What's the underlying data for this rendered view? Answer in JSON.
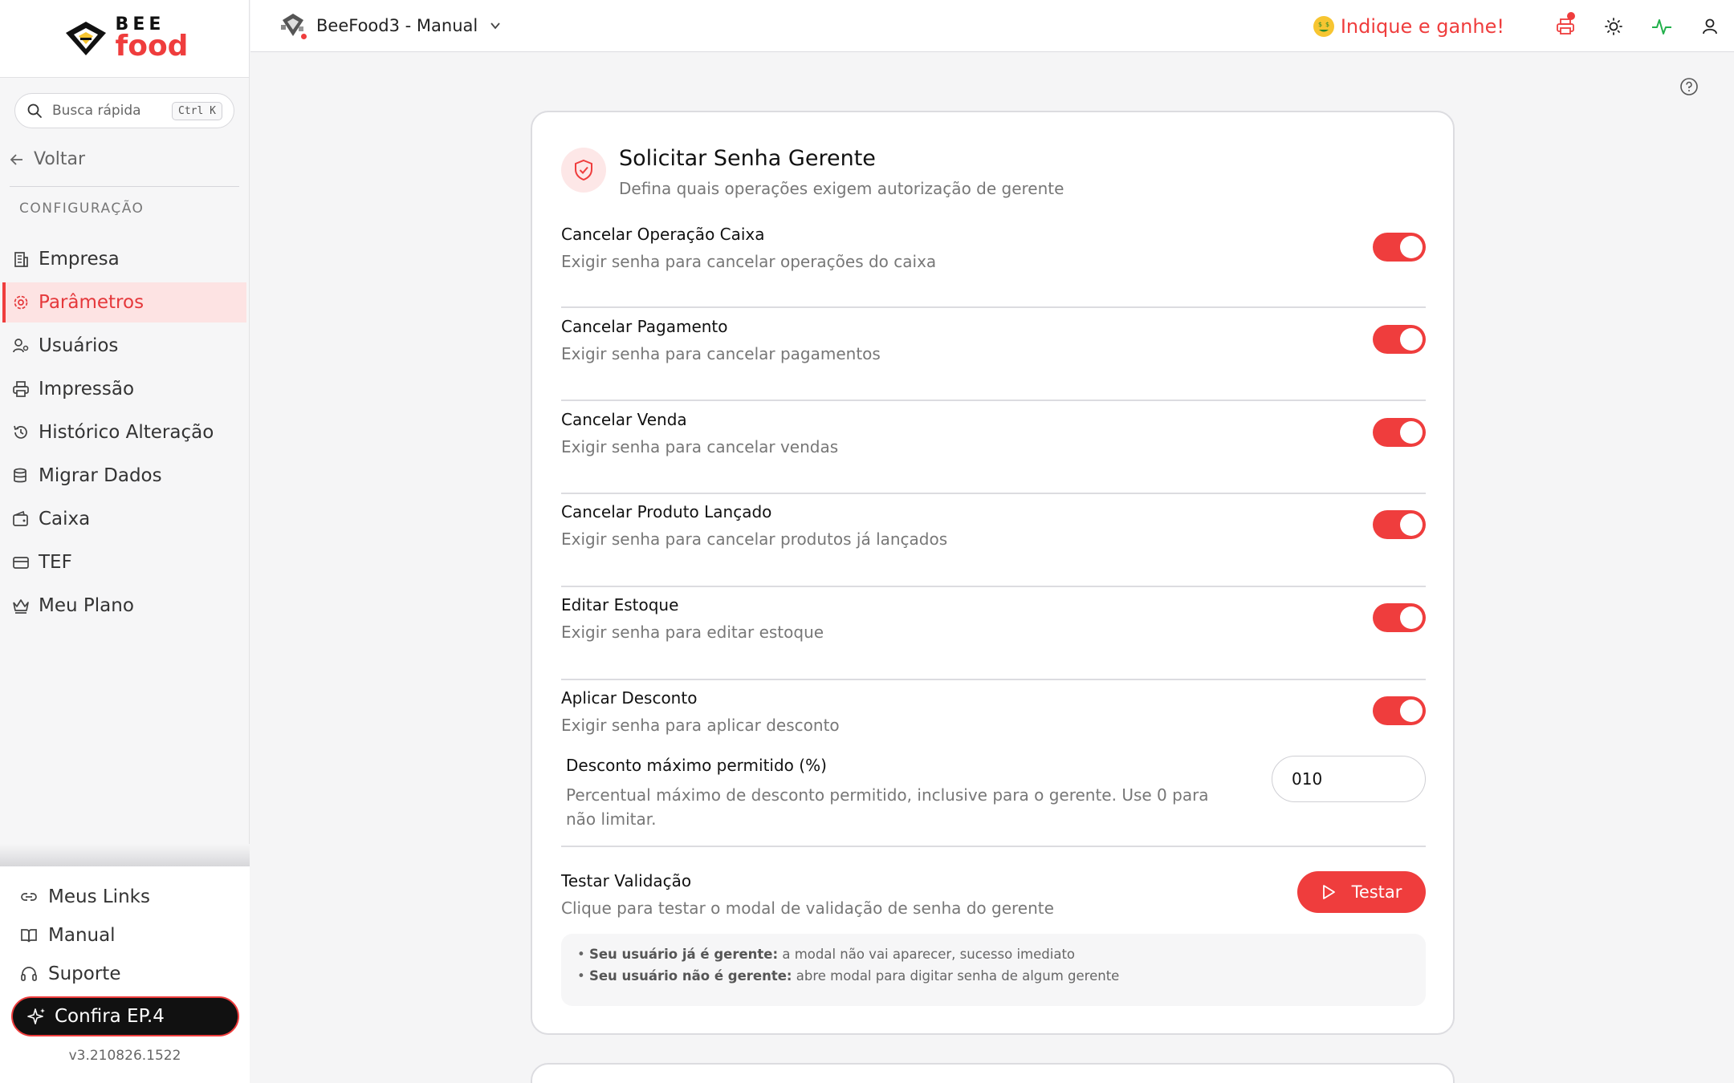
{
  "brand": {
    "line1": "BEE",
    "line2": "food"
  },
  "search": {
    "placeholder": "Busca rápida",
    "shortcut": "Ctrl K"
  },
  "nav_back": "Voltar",
  "section_label": "CONFIGURAÇÃO",
  "sidebar": {
    "items": [
      {
        "label": "Empresa",
        "icon": "building-icon"
      },
      {
        "label": "Parâmetros",
        "icon": "gear-icon",
        "active": true
      },
      {
        "label": "Usuários",
        "icon": "users-icon"
      },
      {
        "label": "Impressão",
        "icon": "printer-icon"
      },
      {
        "label": "Histórico Alteração",
        "icon": "history-icon"
      },
      {
        "label": "Migrar Dados",
        "icon": "database-icon"
      },
      {
        "label": "Caixa",
        "icon": "wallet-icon"
      },
      {
        "label": "TEF",
        "icon": "card-icon"
      },
      {
        "label": "Meu Plano",
        "icon": "crown-icon"
      }
    ],
    "bottom": [
      {
        "label": "Meus Links",
        "icon": "link-icon"
      },
      {
        "label": "Manual",
        "icon": "book-icon"
      },
      {
        "label": "Suporte",
        "icon": "headset-icon"
      }
    ],
    "promo": "Confira EP.4",
    "version": "v3.210826.1522"
  },
  "topbar": {
    "store_name": "BeeFood3 - Manual",
    "referral": "Indique e ganhe!"
  },
  "card": {
    "title": "Solicitar Senha Gerente",
    "subtitle": "Defina quais operações exigem autorização de gerente",
    "options": [
      {
        "label": "Cancelar Operação Caixa",
        "desc": "Exigir senha para cancelar operações do caixa",
        "enabled": true
      },
      {
        "label": "Cancelar Pagamento",
        "desc": "Exigir senha para cancelar pagamentos",
        "enabled": true
      },
      {
        "label": "Cancelar Venda",
        "desc": "Exigir senha para cancelar vendas",
        "enabled": true
      },
      {
        "label": "Cancelar Produto Lançado",
        "desc": "Exigir senha para cancelar produtos já lançados",
        "enabled": true
      },
      {
        "label": "Editar Estoque",
        "desc": "Exigir senha para editar estoque",
        "enabled": true
      },
      {
        "label": "Aplicar Desconto",
        "desc": "Exigir senha para aplicar desconto",
        "enabled": true
      }
    ],
    "discount": {
      "label": "Desconto máximo permitido (%)",
      "desc": "Percentual máximo de desconto permitido, inclusive para o gerente. Use 0 para não limitar.",
      "value": "010"
    },
    "test": {
      "label": "Testar Validação",
      "desc": "Clique para testar o modal de validação de senha do gerente",
      "button": "Testar"
    },
    "notes": [
      {
        "bold": "Seu usuário já é gerente:",
        "text": " a modal não vai aparecer, sucesso imediato"
      },
      {
        "bold": "Seu usuário não é gerente:",
        "text": " abre modal para digitar senha de algum gerente"
      }
    ]
  },
  "colors": {
    "accent": "#ef3d3d",
    "active_bg": "#fde3e3",
    "pulse": "#22b04b"
  }
}
